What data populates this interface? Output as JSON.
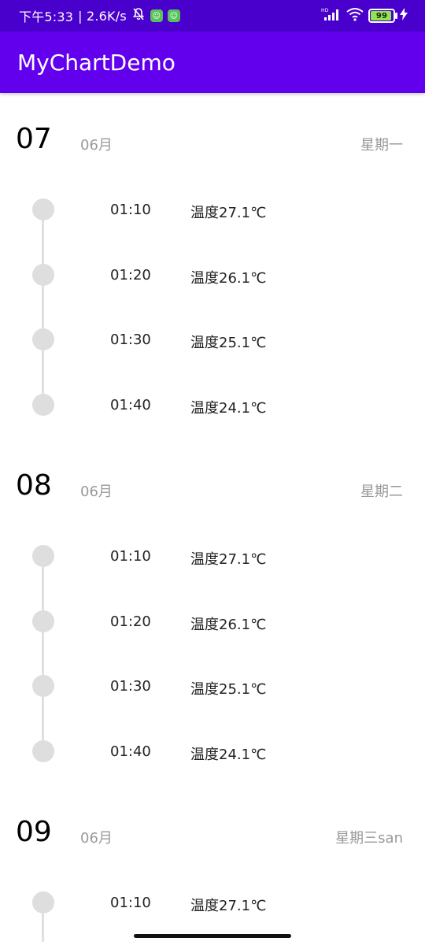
{
  "status_bar": {
    "time_text": "下午5:33",
    "speed_text": "| 2.6K/s",
    "battery_level": "99",
    "icons": [
      "mute-icon",
      "app-badge-icon",
      "app-badge-icon",
      "hd-icon",
      "signal-icon",
      "wifi-icon",
      "battery-icon",
      "charging-icon"
    ]
  },
  "app_bar": {
    "title": "MyChartDemo"
  },
  "days": [
    {
      "day": "07",
      "month": "06月",
      "weekday": "星期一",
      "entries": [
        {
          "time": "01:10",
          "temp": "温度27.1℃"
        },
        {
          "time": "01:20",
          "temp": "温度26.1℃"
        },
        {
          "time": "01:30",
          "temp": "温度25.1℃"
        },
        {
          "time": "01:40",
          "temp": "温度24.1℃"
        }
      ]
    },
    {
      "day": "08",
      "month": "06月",
      "weekday": "星期二",
      "entries": [
        {
          "time": "01:10",
          "temp": "温度27.1℃"
        },
        {
          "time": "01:20",
          "temp": "温度26.1℃"
        },
        {
          "time": "01:30",
          "temp": "温度25.1℃"
        },
        {
          "time": "01:40",
          "temp": "温度24.1℃"
        }
      ]
    },
    {
      "day": "09",
      "month": "06月",
      "weekday": "星期三san",
      "entries": [
        {
          "time": "01:10",
          "temp": "温度27.1℃"
        }
      ]
    }
  ],
  "colors": {
    "status_bar": "#4a00cc",
    "app_bar": "#6200ee",
    "timeline_dot": "#dedede",
    "muted_text": "#999999"
  }
}
